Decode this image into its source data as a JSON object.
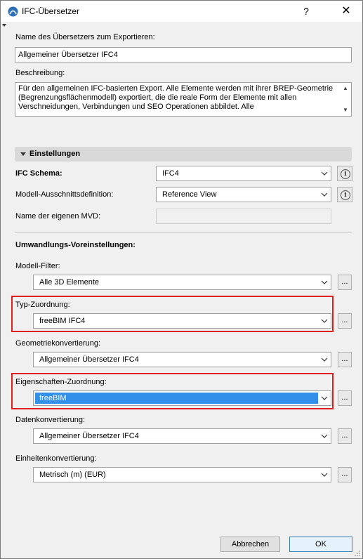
{
  "window": {
    "title": "IFC-Übersetzer",
    "help_label": "?",
    "close_label": "✕"
  },
  "name_field": {
    "label": "Name des Übersetzers zum Exportieren:",
    "value": "Allgemeiner Übersetzer IFC4"
  },
  "description": {
    "label": "Beschreibung:",
    "value": "Für den allgemeinen IFC-basierten Export. Alle Elemente werden mit ihrer BREP-Geometrie (Begrenzungsflächenmodell) exportiert, die die reale Form der Elemente mit allen Verschneidungen, Verbindungen und SEO Operationen abbildet. Alle"
  },
  "settings": {
    "header": "Einstellungen",
    "ifc_schema": {
      "label": "IFC Schema:",
      "value": "IFC4",
      "info": "i"
    },
    "model_view": {
      "label": "Modell-Ausschnittsdefinition:",
      "value": "Reference View",
      "info": "i"
    },
    "custom_mvd": {
      "label": "Name der eigenen MVD:",
      "value": ""
    }
  },
  "conversion": {
    "header": "Umwandlungs-Voreinstellungen:",
    "dots": "...",
    "model_filter": {
      "label": "Modell-Filter:",
      "value": "Alle 3D Elemente"
    },
    "type_mapping": {
      "label": "Typ-Zuordnung:",
      "value": "freeBIM IFC4"
    },
    "geometry": {
      "label": "Geometriekonvertierung:",
      "value": "Allgemeiner Übersetzer IFC4"
    },
    "property_mapping": {
      "label": "Eigenschaften-Zuordnung:",
      "value": "freeBIM"
    },
    "data_conversion": {
      "label": "Datenkonvertierung:",
      "value": "Allgemeiner Übersetzer IFC4"
    },
    "unit_conversion": {
      "label": "Einheitenkonvertierung:",
      "value": "Metrisch (m) (EUR)"
    }
  },
  "buttons": {
    "cancel": "Abbrechen",
    "ok": "OK"
  },
  "colors": {
    "highlight_border": "#e0201f",
    "selection": "#3390ea"
  }
}
